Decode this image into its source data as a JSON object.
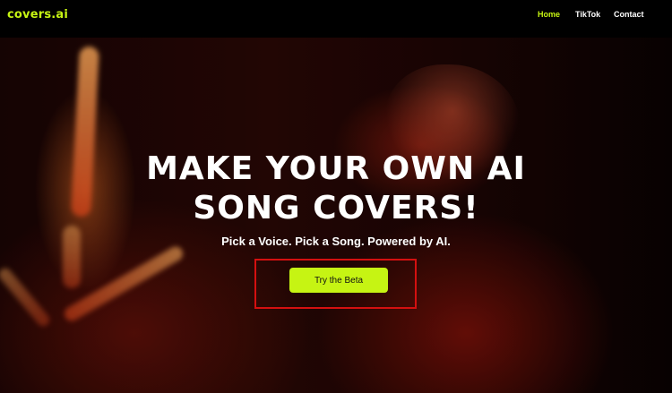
{
  "nav": {
    "logo": "covers.ai",
    "links": [
      "Home",
      "TikTok",
      "Contact"
    ]
  },
  "hero": {
    "headline_line1": "MAKE YOUR OWN AI",
    "headline_line2": "SONG COVERS!",
    "subheadline": "Pick a Voice.  Pick a Song. Powered by AI.",
    "cta_label": "Try the Beta"
  },
  "colors": {
    "accent": "#c6f413",
    "active_nav": "#c6f413",
    "nav_background": "#000000",
    "highlight_border": "#d41010"
  }
}
